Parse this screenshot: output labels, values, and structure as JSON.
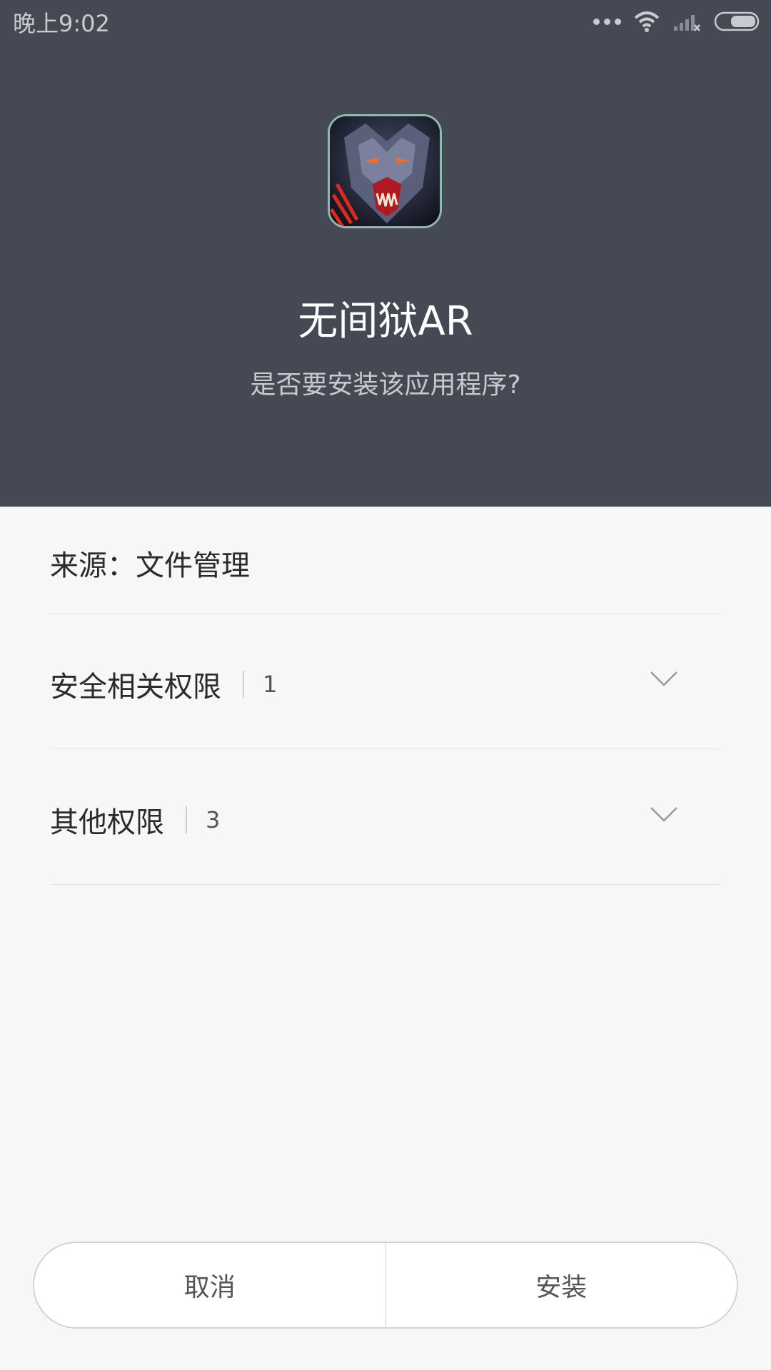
{
  "status_bar": {
    "time": "晚上9:02",
    "icons": [
      "more-dots-icon",
      "wifi-icon",
      "cellular-signal-no-service-icon",
      "battery-icon"
    ]
  },
  "app": {
    "name": "无间狱AR",
    "icon": "werewolf-app-icon",
    "question": "是否要安装该应用程序?"
  },
  "source": {
    "text": "来源：文件管理"
  },
  "permissions": [
    {
      "label": "安全相关权限",
      "count": "1"
    },
    {
      "label": "其他权限",
      "count": "3"
    }
  ],
  "buttons": {
    "cancel": "取消",
    "install": "安装"
  },
  "colors": {
    "header_bg": "#454954",
    "content_bg": "#f7f7f7"
  }
}
